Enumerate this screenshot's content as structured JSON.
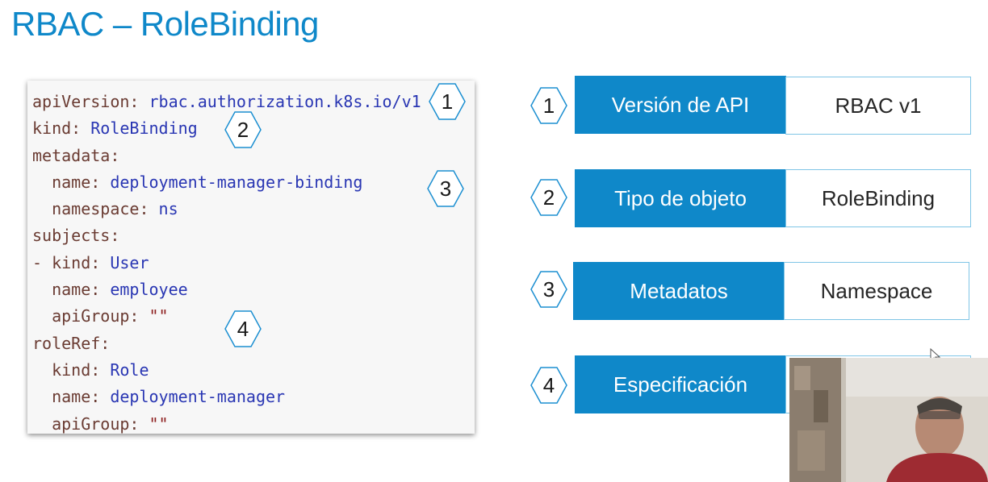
{
  "slide": {
    "title": "RBAC – RoleBinding"
  },
  "code": {
    "lines": [
      {
        "key": "apiVersion: ",
        "val": "rbac.authorization.k8s.io/v1",
        "kind": "v"
      },
      {
        "key": "kind: ",
        "val": "RoleBinding",
        "kind": "v"
      },
      {
        "key": "metadata:",
        "val": "",
        "kind": "v"
      },
      {
        "key": "  name: ",
        "val": "deployment-manager-binding",
        "kind": "v"
      },
      {
        "key": "  namespace: ",
        "val": "ns",
        "kind": "v"
      },
      {
        "key": "subjects:",
        "val": "",
        "kind": "v"
      },
      {
        "key": "- kind: ",
        "val": "User",
        "kind": "v"
      },
      {
        "key": "  name: ",
        "val": "employee",
        "kind": "v"
      },
      {
        "key": "  apiGroup: ",
        "val": "\"\"",
        "kind": "s"
      },
      {
        "key": "roleRef:",
        "val": "",
        "kind": "v"
      },
      {
        "key": "  kind: ",
        "val": "Role",
        "kind": "v"
      },
      {
        "key": "  name: ",
        "val": "deployment-manager",
        "kind": "v"
      },
      {
        "key": "  apiGroup: ",
        "val": "\"\"",
        "kind": "s"
      }
    ],
    "markers": [
      "1",
      "2",
      "3",
      "4"
    ]
  },
  "rows": [
    {
      "number": "1",
      "label": "Versión de API",
      "value": "RBAC v1"
    },
    {
      "number": "2",
      "label": "Tipo de objeto",
      "value": "RoleBinding"
    },
    {
      "number": "3",
      "label": "Metadatos",
      "value": "Namespace"
    },
    {
      "number": "4",
      "label": "Especificación",
      "value": ""
    }
  ],
  "colors": {
    "accent": "#0f88c9",
    "title": "#0f88c9",
    "code_key": "#6a3b32",
    "code_value": "#2936b3",
    "code_string": "#8c1c1c"
  },
  "icons": {
    "marker": "hexagon-number-icon",
    "cursor": "mouse-pointer-icon"
  }
}
